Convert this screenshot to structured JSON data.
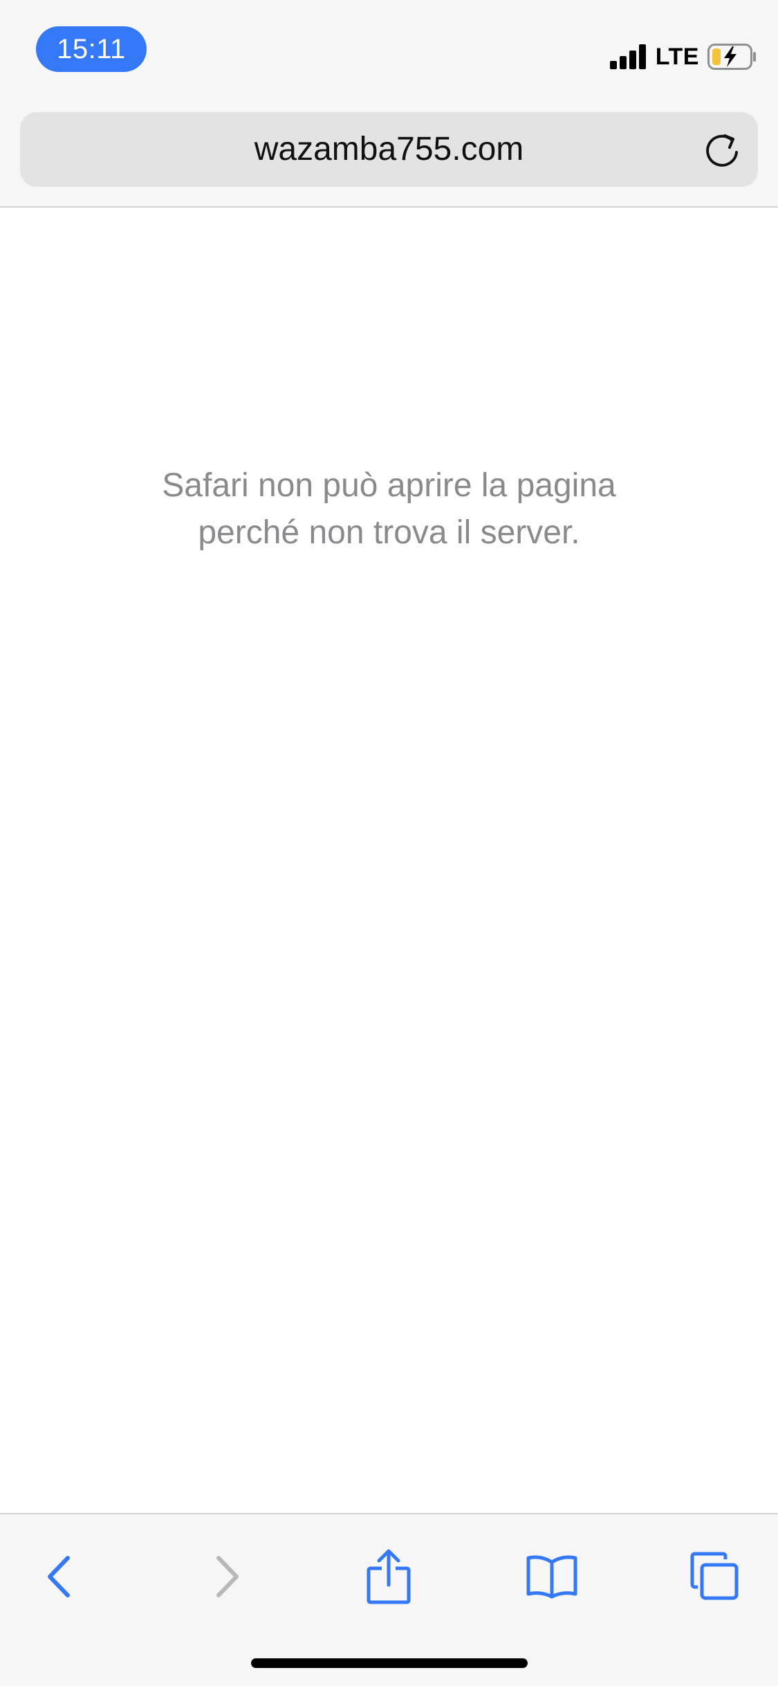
{
  "status_bar": {
    "time": "15:11",
    "network": "LTE",
    "icons": [
      "signal-bars-icon",
      "battery-charging-icon"
    ]
  },
  "address_bar": {
    "url": "wazamba755.com",
    "reload_icon": "reload-icon"
  },
  "page": {
    "error_line_1": "Safari non può aprire la pagina",
    "error_line_2": "perché non trova il server."
  },
  "toolbar": {
    "icons": [
      "back-icon",
      "forward-icon",
      "share-icon",
      "bookmarks-icon",
      "tabs-icon"
    ]
  },
  "colors": {
    "accent": "#3478f6",
    "chrome_background": "#f6f6f6",
    "address_field": "#e3e3e4",
    "message_text": "#8a8a8e",
    "disabled_icon": "#b8b8bc",
    "battery_charge": "#f5c33b"
  }
}
